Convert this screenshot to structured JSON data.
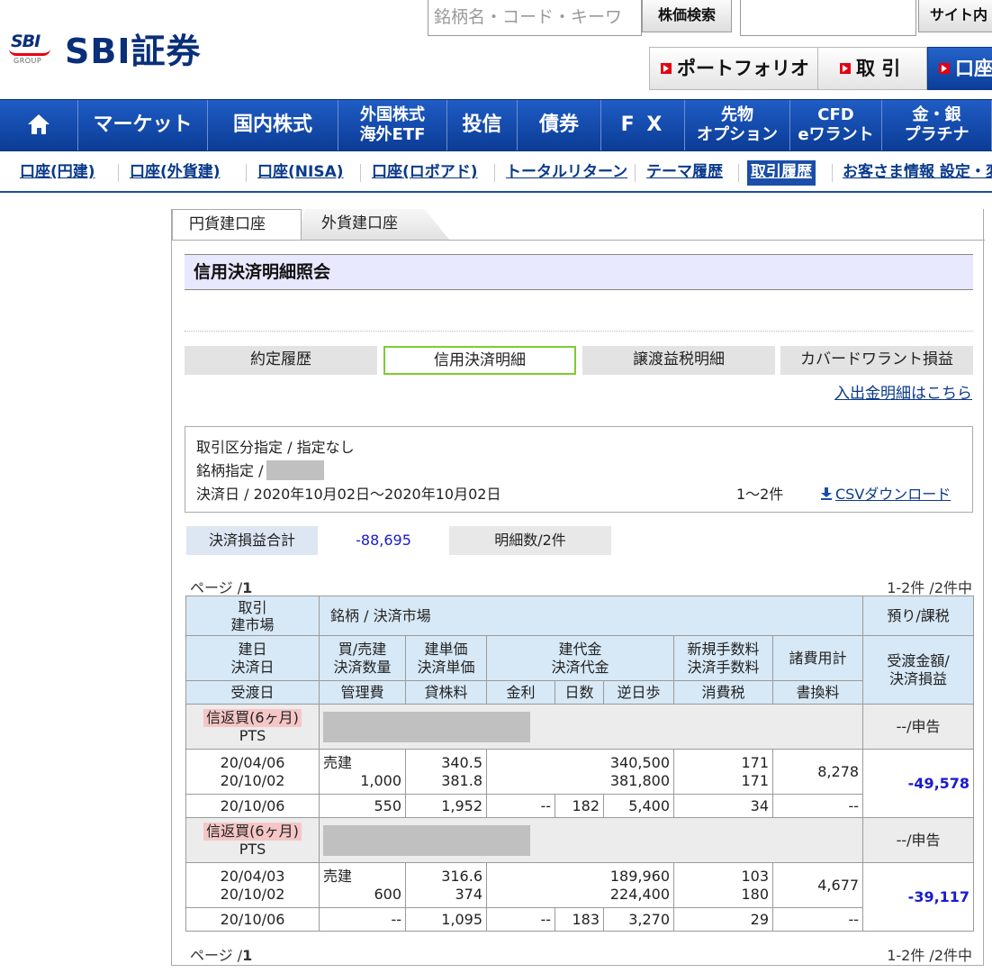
{
  "header": {
    "logo_mark": "SBI",
    "logo_group": "GROUP",
    "logo_text": "SBI証券",
    "search_placeholder": "銘柄名・コード・キーワ",
    "stock_search_label": "株価検索",
    "site_search_label": "サイト内",
    "portfolio_label": "ポートフォリオ",
    "trade_label": "取 引",
    "account_label": "口座"
  },
  "main_nav": {
    "market": "マーケット",
    "domestic": "国内株式",
    "foreign_1": "外国株式",
    "foreign_2": "海外ETF",
    "fund": "投信",
    "bond": "債券",
    "fx": "F X",
    "futures_1": "先物",
    "futures_2": "オプション",
    "cfd_1": "CFD",
    "cfd_2": "eワラント",
    "gold_1": "金・銀",
    "gold_2": "プラチナ"
  },
  "sub_nav": {
    "yen": "口座(円建)",
    "foreign": "口座(外貨建)",
    "nisa": "口座(NISA)",
    "robo": "口座(ロボアド)",
    "total": "トータルリターン",
    "theme": "テーマ履歴",
    "history": "取引履歴",
    "customer": "お客さま情報 設定・変"
  },
  "tabs": {
    "yen": "円貨建口座",
    "foreign": "外貨建口座"
  },
  "page_title": "信用決済明細照会",
  "subtabs": {
    "contract": "約定履歴",
    "margin": "信用決済明細",
    "tax": "譲渡益税明細",
    "warrant": "カバードワラント損益"
  },
  "deposit_link": "入出金明細はこちら",
  "filter": {
    "trade_type": "取引区分指定 / 指定なし",
    "stock": "銘柄指定 /",
    "date_range": "決済日 / 2020年10月02日～2020年10月02日",
    "count": "1～2件",
    "csv": "CSVダウンロード"
  },
  "summary": {
    "label": "決済損益合計",
    "value": "-88,695",
    "count": "明細数/2件"
  },
  "pagination": {
    "page": "ページ /",
    "page_num": "1",
    "range": "1-2件 /2件中"
  },
  "table": {
    "h_trade": "取引",
    "h_market_open": "建市場",
    "h_stock": "銘柄 / 決済市場",
    "h_deposit": "預り/課税",
    "h_open_date": "建日",
    "h_settle_date": "決済日",
    "h_buysell": "買/売建",
    "h_qty": "決済数量",
    "h_open_price": "建単価",
    "h_settle_price": "決済単価",
    "h_open_amount": "建代金",
    "h_settle_amount": "決済代金",
    "h_new_fee": "新規手数料",
    "h_settle_fee": "決済手数料",
    "h_expenses": "諸費用計",
    "h_pl_1": "受渡金額/",
    "h_pl_2": "決済損益",
    "h_delivery": "受渡日",
    "h_mgmt": "管理費",
    "h_lending": "貸株料",
    "h_interest": "金利",
    "h_days": "日数",
    "h_reverse": "逆日歩",
    "h_tax": "消費税",
    "h_rewrite": "書換料",
    "rows": [
      {
        "type": "信返買(6ヶ月)",
        "market": "PTS",
        "deposit": "--/申告",
        "open_date": "20/04/06",
        "settle_date": "20/10/02",
        "side": "売建",
        "qty": "1,000",
        "open_price": "340.5",
        "settle_price": "381.8",
        "open_amount": "340,500",
        "settle_amount": "381,800",
        "new_fee": "171",
        "settle_fee": "171",
        "expenses": "8,278",
        "pl": "-49,578",
        "delivery": "20/10/06",
        "mgmt": "550",
        "lending": "1,952",
        "interest": "--",
        "days": "182",
        "reverse": "5,400",
        "tax": "34",
        "rewrite": "--"
      },
      {
        "type": "信返買(6ヶ月)",
        "market": "PTS",
        "deposit": "--/申告",
        "open_date": "20/04/03",
        "settle_date": "20/10/02",
        "side": "売建",
        "qty": "600",
        "open_price": "316.6",
        "settle_price": "374",
        "open_amount": "189,960",
        "settle_amount": "224,400",
        "new_fee": "103",
        "settle_fee": "180",
        "expenses": "4,677",
        "pl": "-39,117",
        "delivery": "20/10/06",
        "mgmt": "--",
        "lending": "1,095",
        "interest": "--",
        "days": "183",
        "reverse": "3,270",
        "tax": "29",
        "rewrite": "--"
      }
    ]
  },
  "colors": {
    "brand_navy": "#0a2f7a",
    "nav_blue": "#1b4ea8",
    "brand_red": "#e60012",
    "header_cell": "#d7e8f6",
    "negative": "#1a1ad0"
  }
}
